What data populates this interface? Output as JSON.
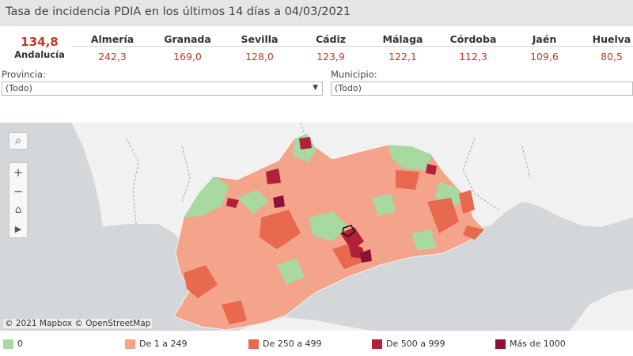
{
  "title": "Tasa de incidencia PDIA en los últimos 14 días a 04/03/2021",
  "region": {
    "value": "134,8",
    "name": "Andalucía"
  },
  "provinces": [
    {
      "name": "Almería",
      "value": "242,3"
    },
    {
      "name": "Granada",
      "value": "169,0"
    },
    {
      "name": "Sevilla",
      "value": "128,0"
    },
    {
      "name": "Cádiz",
      "value": "123,9"
    },
    {
      "name": "Málaga",
      "value": "122,1"
    },
    {
      "name": "Córdoba",
      "value": "112,3"
    },
    {
      "name": "Jaén",
      "value": "109,6"
    },
    {
      "name": "Huelva",
      "value": "80,5"
    }
  ],
  "filters": {
    "provincia": {
      "label": "Provincia:",
      "value": "(Todo)"
    },
    "municipio": {
      "label": "Municipio:",
      "value": "(Todo)"
    }
  },
  "map": {
    "attribution": "© 2021 Mapbox  © OpenStreetMap",
    "sea_color": "#d3d7da",
    "land_color": "#f1f1f1",
    "controls": [
      "search-icon",
      "zoom-in-icon",
      "zoom-out-icon",
      "home-icon",
      "play-icon"
    ]
  },
  "legend": [
    {
      "label": "0",
      "color": "#a7d9a0"
    },
    {
      "label": "De 1 a 249",
      "color": "#f4a48a"
    },
    {
      "label": "De 250 a 499",
      "color": "#e8694e"
    },
    {
      "label": "De 500 a 999",
      "color": "#b2213a"
    },
    {
      "label": "Más de 1000",
      "color": "#8c1136"
    }
  ]
}
